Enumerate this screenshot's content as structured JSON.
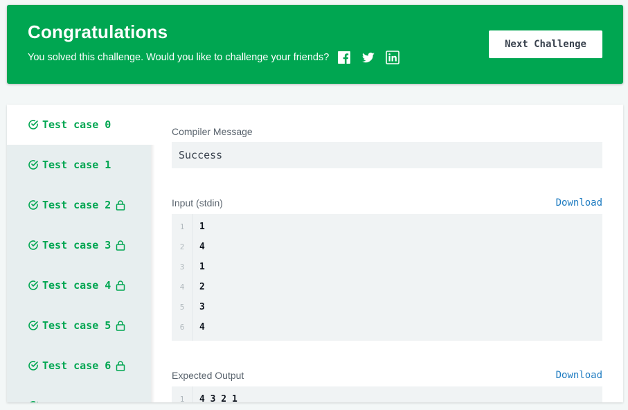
{
  "banner": {
    "title": "Congratulations",
    "subtitle": "You solved this challenge. Would you like to challenge your friends?",
    "social_icons": [
      "facebook-icon",
      "twitter-icon",
      "linkedin-icon"
    ],
    "next_button": "Next Challenge",
    "color": "#00a651"
  },
  "tabs": [
    {
      "label": "Test case 0",
      "locked": false,
      "active": true
    },
    {
      "label": "Test case 1",
      "locked": false,
      "active": false
    },
    {
      "label": "Test case 2",
      "locked": true,
      "active": false
    },
    {
      "label": "Test case 3",
      "locked": true,
      "active": false
    },
    {
      "label": "Test case 4",
      "locked": true,
      "active": false
    },
    {
      "label": "Test case 5",
      "locked": true,
      "active": false
    },
    {
      "label": "Test case 6",
      "locked": true,
      "active": false
    }
  ],
  "compiler": {
    "label": "Compiler Message",
    "message": "Success"
  },
  "input": {
    "label": "Input (stdin)",
    "download": "Download",
    "lines": [
      "1",
      "4",
      "1",
      "2",
      "3",
      "4"
    ]
  },
  "expected": {
    "label": "Expected Output",
    "download": "Download",
    "lines": [
      "4 3 2 1"
    ]
  },
  "colors": {
    "accent": "#00a651",
    "link": "#1f7cc1",
    "code_bg": "#f0f3f4"
  }
}
